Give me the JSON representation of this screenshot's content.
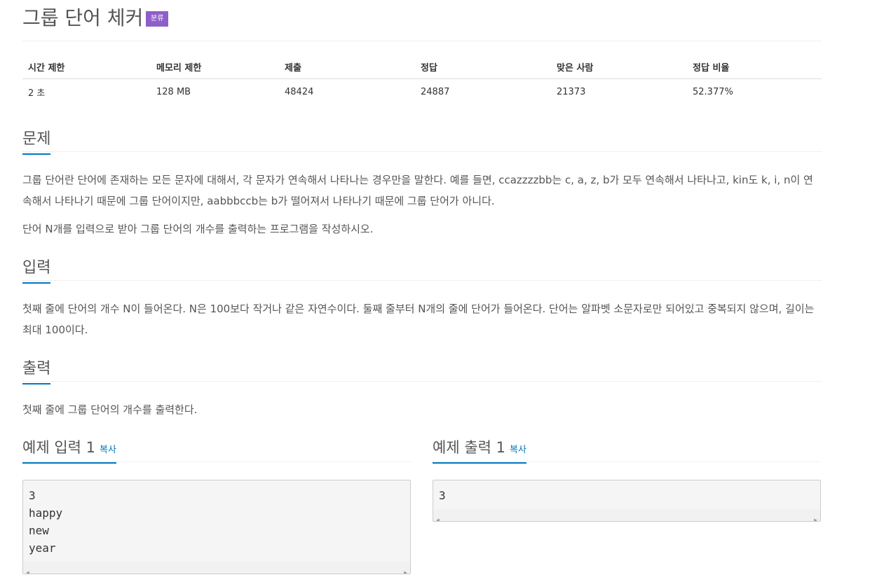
{
  "header": {
    "title": "그룹 단어 체커",
    "badge": "분류"
  },
  "info": {
    "headers": [
      "시간 제한",
      "메모리 제한",
      "제출",
      "정답",
      "맞은 사람",
      "정답 비율"
    ],
    "values": [
      "2 초",
      "128 MB",
      "48424",
      "24887",
      "21373",
      "52.377%"
    ]
  },
  "problem": {
    "heading": "문제",
    "p1": "그룹 단어란 단어에 존재하는 모든 문자에 대해서, 각 문자가 연속해서 나타나는 경우만을 말한다. 예를 들면, ccazzzzbb는 c, a, z, b가 모두 연속해서 나타나고, kin도 k, i, n이 연속해서 나타나기 때문에 그룹 단어이지만, aabbbccb는 b가 떨어져서 나타나기 때문에 그룹 단어가 아니다.",
    "p2": "단어 N개를 입력으로 받아 그룹 단어의 개수를 출력하는 프로그램을 작성하시오."
  },
  "input": {
    "heading": "입력",
    "p1": "첫째 줄에 단어의 개수 N이 들어온다. N은 100보다 작거나 같은 자연수이다. 둘째 줄부터 N개의 줄에 단어가 들어온다. 단어는 알파벳 소문자로만 되어있고 중복되지 않으며, 길이는 최대 100이다."
  },
  "output": {
    "heading": "출력",
    "p1": "첫째 줄에 그룹 단어의 개수를 출력한다."
  },
  "sample_input": {
    "heading": "예제 입력 1",
    "copy": "복사",
    "text": "3\nhappy\nnew\nyear"
  },
  "sample_output": {
    "heading": "예제 출력 1",
    "copy": "복사",
    "text": "3"
  }
}
